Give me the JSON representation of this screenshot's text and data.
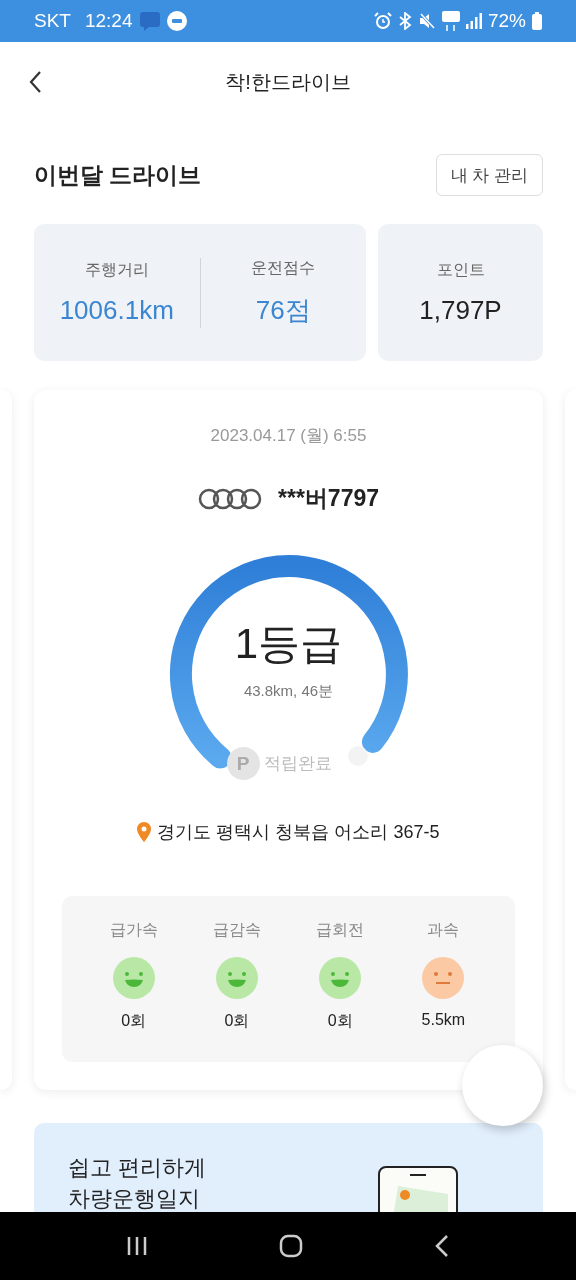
{
  "status_bar": {
    "carrier": "SKT",
    "time": "12:24",
    "battery": "72%"
  },
  "header": {
    "title": "착!한드라이브"
  },
  "section": {
    "title": "이번달 드라이브",
    "button": "내 차 관리"
  },
  "stats": [
    {
      "label": "주행거리",
      "value": "1006.1km",
      "kind": "accent"
    },
    {
      "label": "운전점수",
      "value": "76점",
      "kind": "accent"
    }
  ],
  "points": {
    "label": "포인트",
    "value": "1,797P"
  },
  "trip": {
    "datetime": "2023.04.17 (월) 6:55",
    "plate": "***버7797",
    "grade": "1등급",
    "summary": "43.8km, 46분",
    "reward": {
      "badge": "P",
      "label": "적립완료"
    },
    "address": "경기도 평택시 청북읍 어소리 367-5",
    "behaviors": [
      {
        "label": "급가속",
        "kind": "good",
        "value": "0회"
      },
      {
        "label": "급감속",
        "kind": "good",
        "value": "0회"
      },
      {
        "label": "급회전",
        "kind": "good",
        "value": "0회"
      },
      {
        "label": "과속",
        "kind": "neutral",
        "value": "5.5km"
      }
    ]
  },
  "banner": {
    "lines": [
      "쉽고 편리하게",
      "차량운행일지"
    ]
  }
}
